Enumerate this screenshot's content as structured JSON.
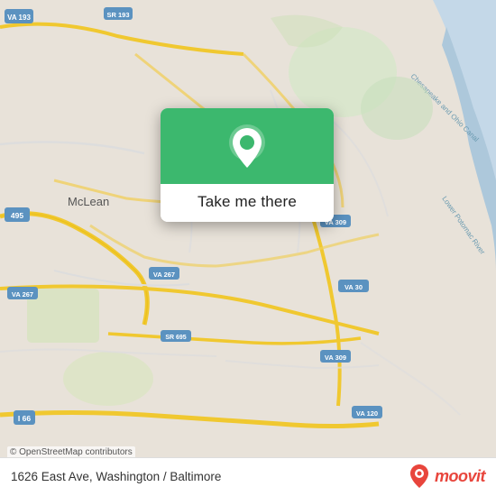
{
  "map": {
    "background_color": "#e8e0d8",
    "attribution": "© OpenStreetMap contributors"
  },
  "card": {
    "button_label": "Take me there",
    "pin_color": "#3cb86e"
  },
  "bottom_bar": {
    "address": "1626 East Ave, Washington / Baltimore",
    "logo_text": "moovit"
  }
}
